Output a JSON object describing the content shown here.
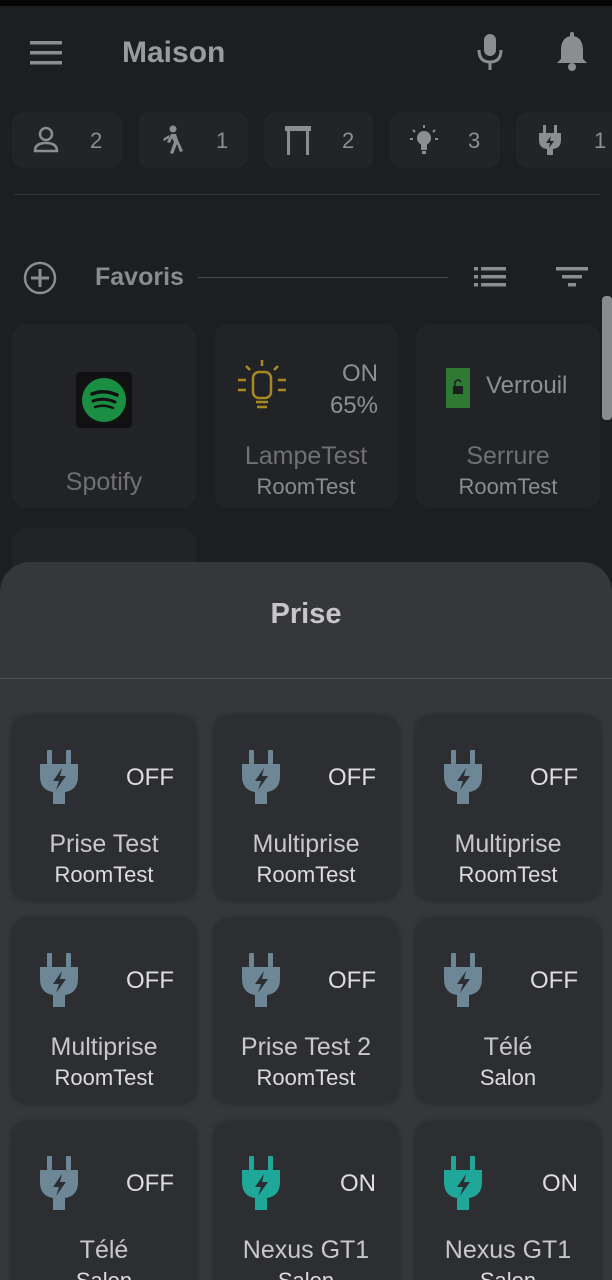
{
  "header": {
    "title": "Maison"
  },
  "chips": [
    {
      "icon": "person-icon",
      "count": "2"
    },
    {
      "icon": "walking-person-icon",
      "count": "1"
    },
    {
      "icon": "door-icon",
      "count": "2"
    },
    {
      "icon": "lightbulb-icon",
      "count": "3"
    },
    {
      "icon": "plug-icon",
      "count": "1"
    }
  ],
  "favorites": {
    "label": "Favoris",
    "cards": [
      {
        "name": "Spotify",
        "room": ""
      },
      {
        "name": "LampeTest",
        "room": "RoomTest",
        "state": "ON",
        "level": "65%"
      },
      {
        "name": "Serrure",
        "room": "RoomTest",
        "state": "Verrouil"
      }
    ]
  },
  "sheet": {
    "title": "Prise",
    "cards": [
      {
        "name": "Prise Test",
        "room": "RoomTest",
        "state": "OFF",
        "on": false
      },
      {
        "name": "Multiprise",
        "room": "RoomTest",
        "state": "OFF",
        "on": false
      },
      {
        "name": "Multiprise",
        "room": "RoomTest",
        "state": "OFF",
        "on": false
      },
      {
        "name": "Multiprise",
        "room": "RoomTest",
        "state": "OFF",
        "on": false
      },
      {
        "name": "Prise Test 2",
        "room": "RoomTest",
        "state": "OFF",
        "on": false
      },
      {
        "name": "Télé",
        "room": "Salon",
        "state": "OFF",
        "on": false
      },
      {
        "name": "Télé",
        "room": "Salon",
        "state": "OFF",
        "on": false
      },
      {
        "name": "Nexus GT1",
        "room": "Salon",
        "state": "ON",
        "on": true
      },
      {
        "name": "Nexus GT1",
        "room": "Salon",
        "state": "ON",
        "on": true
      }
    ]
  },
  "colors": {
    "plug_off": "#6e8796",
    "plug_on": "#1fa89a",
    "spotify": "#1db954",
    "lamp": "#c9a227",
    "lock": "#3aa845"
  }
}
